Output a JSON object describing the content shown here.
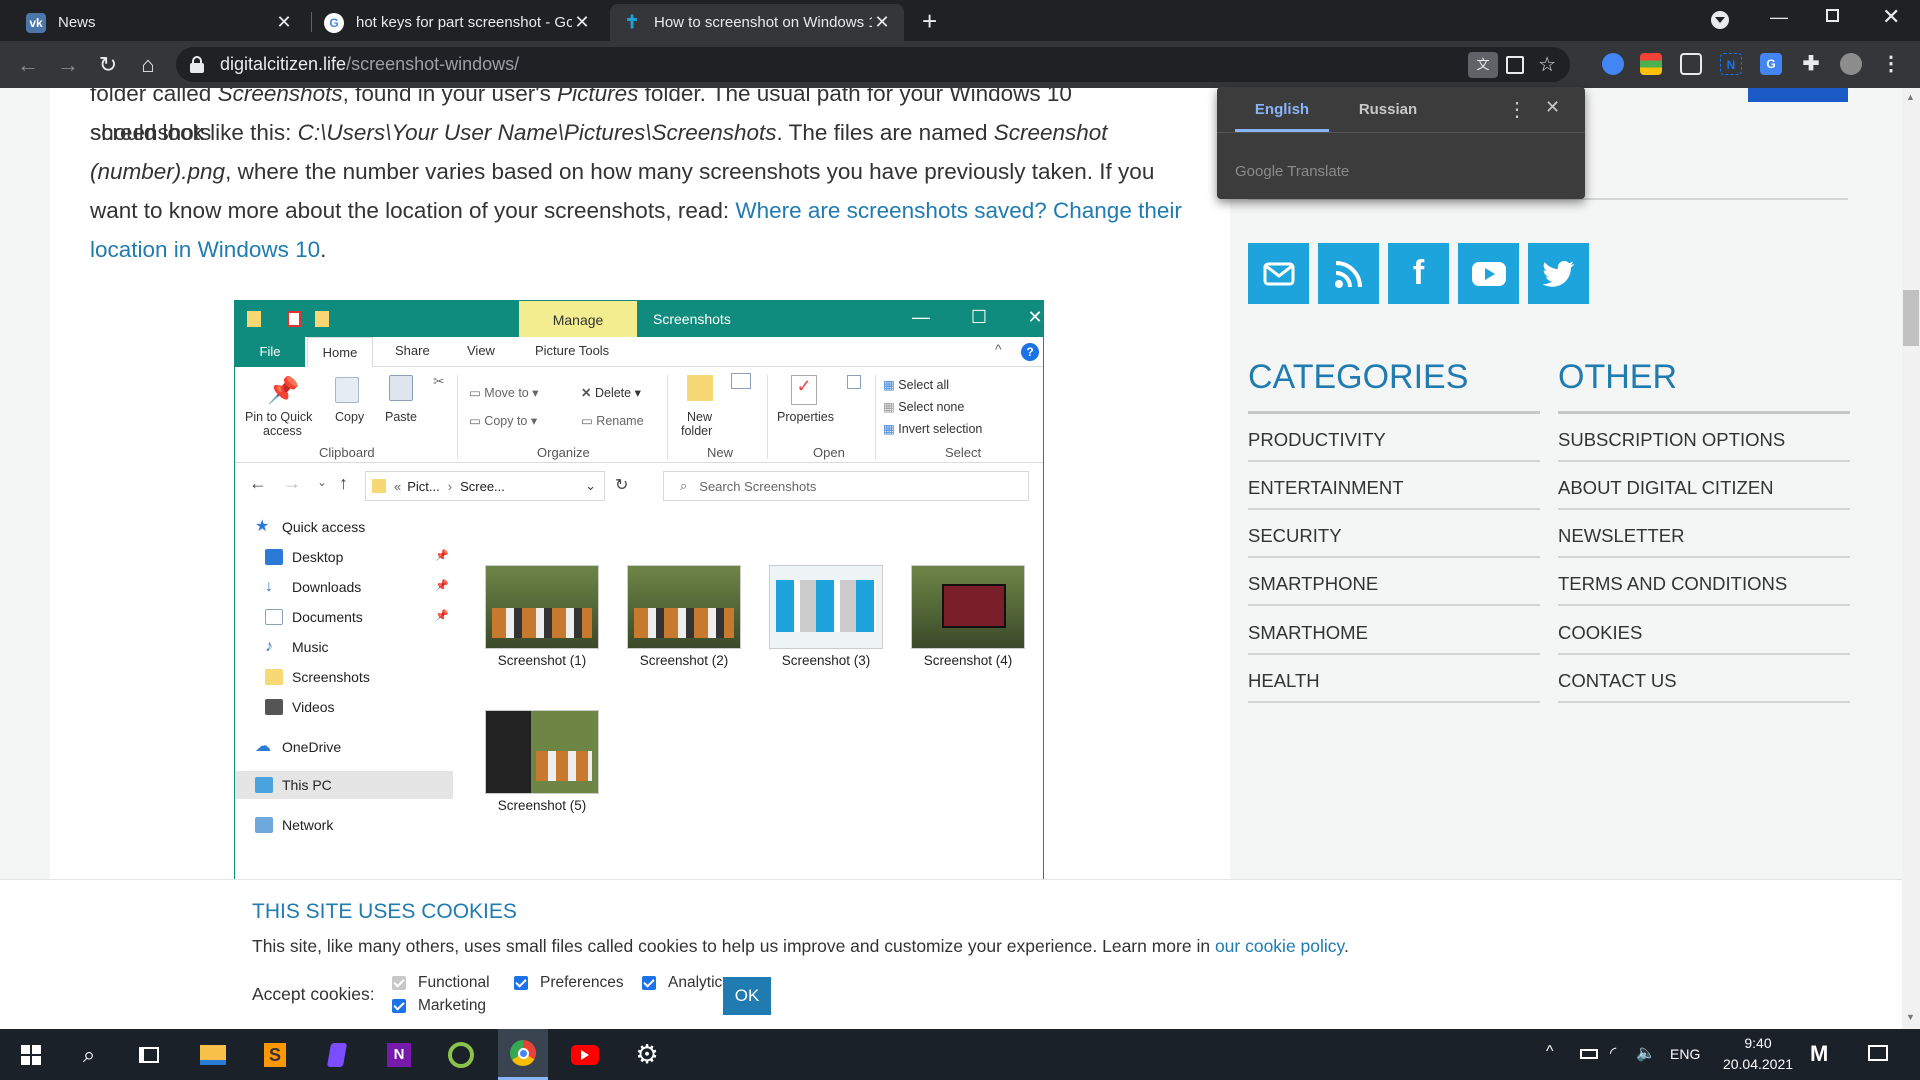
{
  "browser": {
    "tabs": [
      {
        "title": "News",
        "icon": "vk-icon"
      },
      {
        "title": "hot keys for part screenshot - Go",
        "icon": "google-icon"
      },
      {
        "title": "How to screenshot on Windows 1",
        "icon": "digital-citizen-icon"
      }
    ],
    "url_domain": "digitalcitizen.life",
    "url_path": "/screenshot-windows/"
  },
  "article": {
    "p1_a": "folder called ",
    "p1_b": "Screenshots",
    "p1_c": ", found in your user's ",
    "p1_d": "Pictures",
    "p1_e": " folder. The usual path for your Windows 10 screenshots",
    "p2_a": "should look like this: ",
    "p2_b": "C:\\Users\\Your User Name\\Pictures\\Screenshots",
    "p2_c": ". The files are named ",
    "p2_d": "Screenshot",
    "p3_a": "(number).png",
    "p3_b": ", where the number varies based on how many screenshots you have previously taken. If you",
    "p4_a": "want to know more about the location of your screenshots, read: ",
    "p4_link": "Where are screenshots saved? Change their",
    "p5_link": "location in Windows 10",
    "p5_end": "."
  },
  "explorer": {
    "manage": "Manage",
    "title": "Screenshots",
    "tabs": {
      "file": "File",
      "home": "Home",
      "share": "Share",
      "view": "View",
      "picture_tools": "Picture Tools"
    },
    "ribbon": {
      "pin1": "Pin to Quick",
      "pin2": "access",
      "copy": "Copy",
      "paste": "Paste",
      "move_to": "Move to",
      "copy_to": "Copy to",
      "delete": "Delete",
      "rename": "Rename",
      "new_folder1": "New",
      "new_folder2": "folder",
      "properties": "Properties",
      "select_all": "Select all",
      "select_none": "Select none",
      "invert": "Invert selection",
      "g_clipboard": "Clipboard",
      "g_organize": "Organize",
      "g_new": "New",
      "g_open": "Open",
      "g_select": "Select"
    },
    "address_pict": "Pict...",
    "address_scree": "Scree...",
    "search_placeholder": "Search Screenshots",
    "nav": {
      "quick_access": "Quick access",
      "desktop": "Desktop",
      "downloads": "Downloads",
      "documents": "Documents",
      "music": "Music",
      "screenshots": "Screenshots",
      "videos": "Videos",
      "onedrive": "OneDrive",
      "this_pc": "This PC",
      "network": "Network"
    },
    "files": [
      "Screenshot (1)",
      "Screenshot (2)",
      "Screenshot (3)",
      "Screenshot (4)",
      "Screenshot (5)"
    ]
  },
  "translate": {
    "lang1": "English",
    "lang2": "Russian",
    "brand": "Google Translate"
  },
  "sidebar": {
    "categories_title": "CATEGORIES",
    "other_title": "OTHER",
    "categories": [
      "PRODUCTIVITY",
      "ENTERTAINMENT",
      "SECURITY",
      "SMARTPHONE",
      "SMARTHOME",
      "HEALTH"
    ],
    "other": [
      "SUBSCRIPTION OPTIONS",
      "ABOUT DIGITAL CITIZEN",
      "NEWSLETTER",
      "TERMS AND CONDITIONS",
      "COOKIES",
      "CONTACT US"
    ],
    "social_icons": [
      "email-icon",
      "rss-icon",
      "facebook-icon",
      "youtube-icon",
      "twitter-icon"
    ],
    "social_color": "#1ea4dc"
  },
  "cookie": {
    "title": "THIS SITE USES COOKIES",
    "text": "This site, like many others, uses small files called cookies to help us improve and customize your experience. Learn more in ",
    "link": "our cookie policy",
    "text_end": ".",
    "accept_label": "Accept cookies:",
    "functional": "Functional",
    "preferences": "Preferences",
    "analytics": "Analytic",
    "marketing": "Marketing",
    "ok": "OK"
  },
  "taskbar": {
    "lang": "ENG",
    "time": "9:40",
    "date": "20.04.2021"
  },
  "colors": {
    "accent": "#1f7bb0",
    "explorer_teal": "#0f8c7d",
    "manage_yellow": "#f3ed8f"
  }
}
